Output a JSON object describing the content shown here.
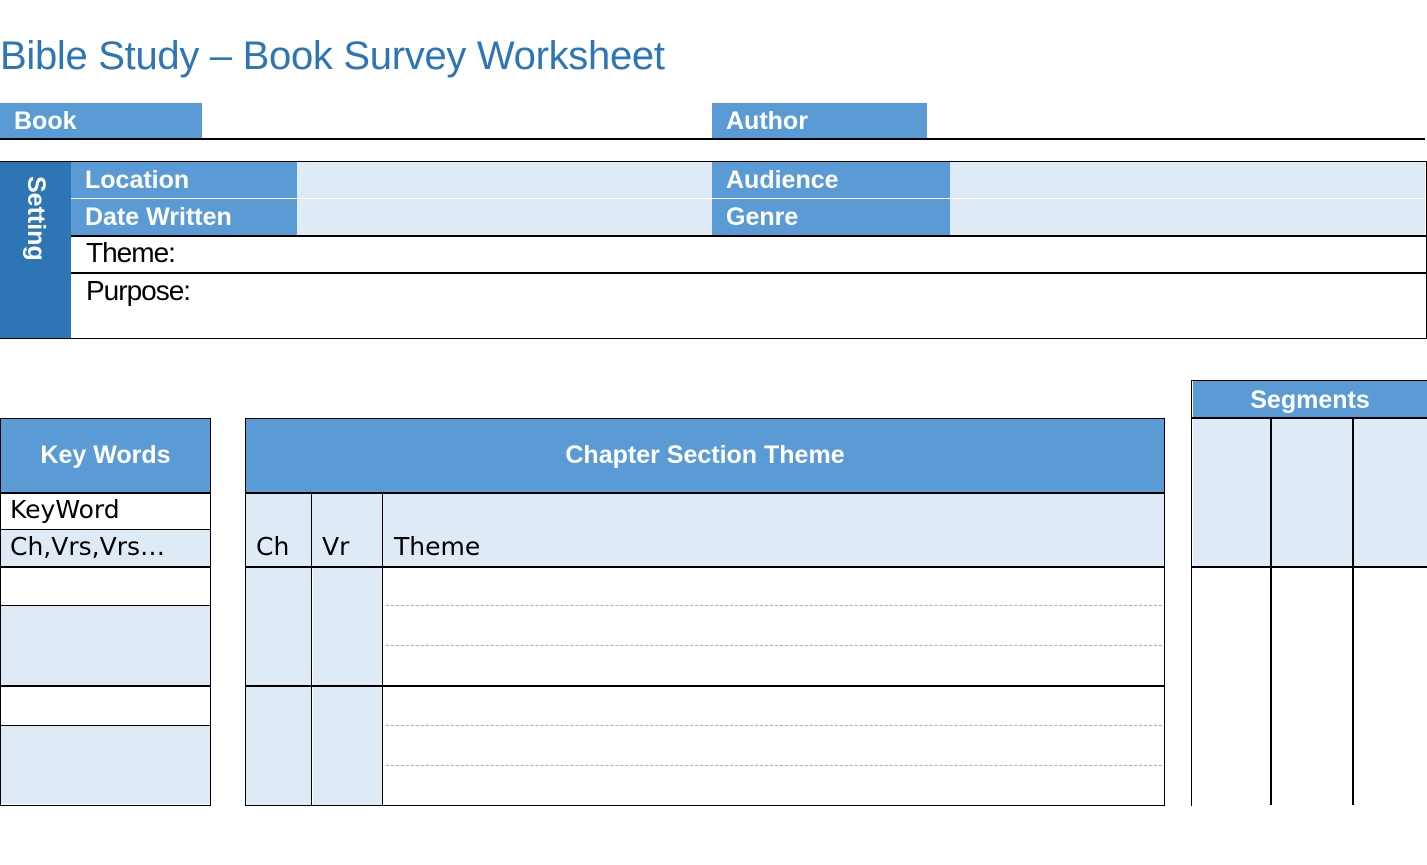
{
  "title": "Bible Study – Book Survey Worksheet",
  "header_fields": {
    "book": "Book",
    "author": "Author"
  },
  "setting": {
    "label": "Setting",
    "location": "Location",
    "date_written": "Date Written",
    "audience": "Audience",
    "genre": "Genre",
    "theme": "Theme:",
    "purpose": "Purpose:"
  },
  "key_words": {
    "header": "Key Words",
    "keyword": "KeyWord",
    "refs": "Ch,Vrs,Vrs…"
  },
  "chapter_section_theme": {
    "header": "Chapter Section Theme",
    "col_ch": "Ch",
    "col_vr": "Vr",
    "col_theme": "Theme"
  },
  "segments": {
    "header": "Segments"
  },
  "colors": {
    "accent": "#5b9bd5",
    "dark_accent": "#2e75b6",
    "light_fill": "#deeaf6"
  }
}
